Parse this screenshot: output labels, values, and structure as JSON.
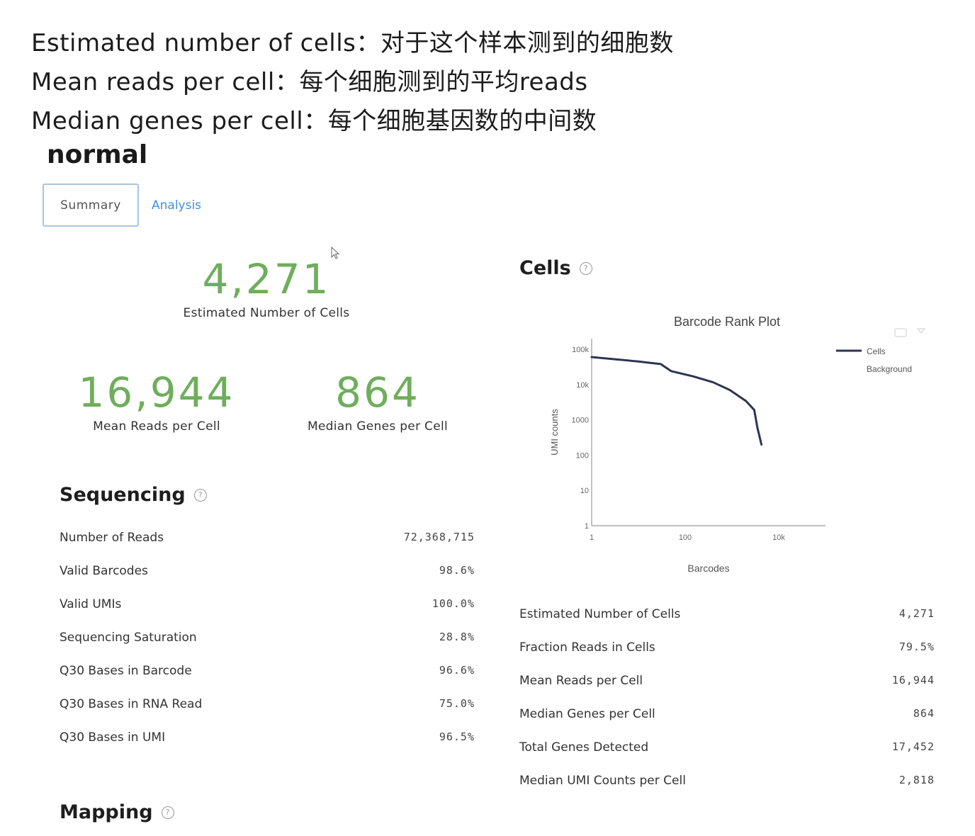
{
  "notes": [
    "Estimated number of cells：对于这个样本测到的细胞数",
    "Mean reads per cell：每个细胞测到的平均reads",
    "Median genes per cell：每个细胞基因数的中间数"
  ],
  "sample": {
    "title": "normal"
  },
  "tabs": {
    "summary": "Summary",
    "analysis": "Analysis"
  },
  "headline": {
    "cells": {
      "value": "4,271",
      "label": "Estimated Number of Cells"
    },
    "reads": {
      "value": "16,944",
      "label": "Mean Reads per Cell"
    },
    "genes": {
      "value": "864",
      "label": "Median Genes per Cell"
    }
  },
  "sequencing": {
    "title": "Sequencing",
    "rows": [
      {
        "label": "Number of Reads",
        "value": "72,368,715"
      },
      {
        "label": "Valid Barcodes",
        "value": "98.6%"
      },
      {
        "label": "Valid UMIs",
        "value": "100.0%"
      },
      {
        "label": "Sequencing Saturation",
        "value": "28.8%"
      },
      {
        "label": "Q30 Bases in Barcode",
        "value": "96.6%"
      },
      {
        "label": "Q30 Bases in RNA Read",
        "value": "75.0%"
      },
      {
        "label": "Q30 Bases in UMI",
        "value": "96.5%"
      }
    ]
  },
  "mapping": {
    "title": "Mapping"
  },
  "cells_section": {
    "title": "Cells",
    "rows": [
      {
        "label": "Estimated Number of Cells",
        "value": "4,271"
      },
      {
        "label": "Fraction Reads in Cells",
        "value": "79.5%"
      },
      {
        "label": "Mean Reads per Cell",
        "value": "16,944"
      },
      {
        "label": "Median Genes per Cell",
        "value": "864"
      },
      {
        "label": "Total Genes Detected",
        "value": "17,452"
      },
      {
        "label": "Median UMI Counts per Cell",
        "value": "2,818"
      }
    ]
  },
  "chart_data": {
    "type": "line",
    "title": "Barcode Rank Plot",
    "xlabel": "Barcodes",
    "ylabel": "UMI counts",
    "x_scale": "log",
    "y_scale": "log",
    "x_ticks": [
      "1",
      "100",
      "10k"
    ],
    "y_ticks": [
      "1",
      "10",
      "100",
      "1000",
      "10k",
      "100k"
    ],
    "legend": [
      "Cells",
      "Background"
    ],
    "legend_position": "top-right",
    "series": [
      {
        "name": "Cells",
        "color": "#2d3550",
        "points": [
          [
            1,
            60000
          ],
          [
            10,
            45000
          ],
          [
            30,
            38000
          ],
          [
            50,
            24000
          ],
          [
            150,
            17000
          ],
          [
            400,
            11500
          ],
          [
            900,
            7000
          ],
          [
            2000,
            3400
          ],
          [
            3000,
            1900
          ],
          [
            3500,
            600
          ],
          [
            4271,
            200
          ]
        ]
      }
    ]
  }
}
